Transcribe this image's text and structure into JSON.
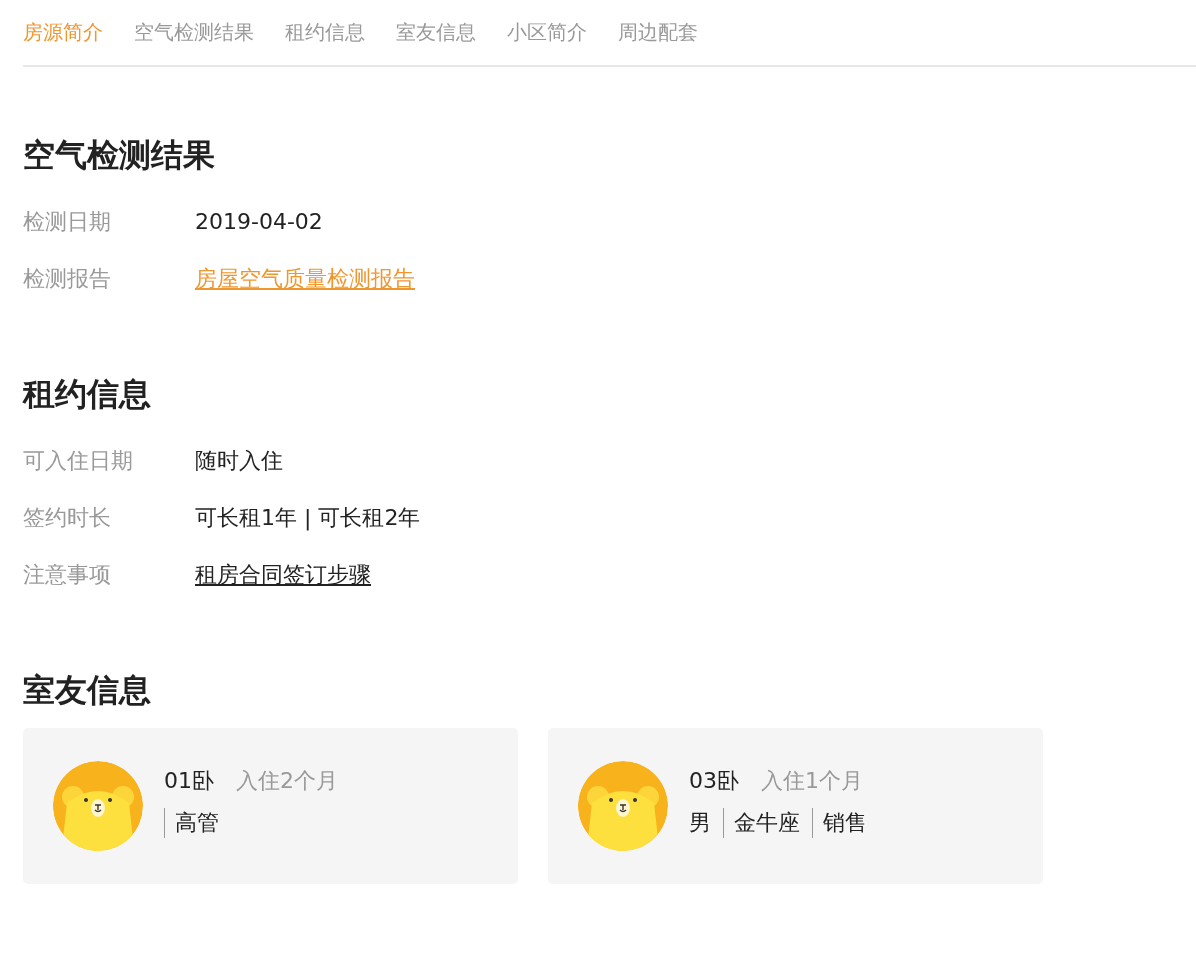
{
  "tabs": [
    {
      "label": "房源简介",
      "selected": true
    },
    {
      "label": "空气检测结果",
      "selected": false
    },
    {
      "label": "租约信息",
      "selected": false
    },
    {
      "label": "室友信息",
      "selected": false
    },
    {
      "label": "小区简介",
      "selected": false
    },
    {
      "label": "周边配套",
      "selected": false
    }
  ],
  "sections": [
    {
      "title": "空气检测结果",
      "rows": [
        {
          "label": "检测日期",
          "value": "2019-04-02",
          "kind": "text"
        },
        {
          "label": "检测报告",
          "value": "房屋空气质量检测报告",
          "kind": "accent-link"
        }
      ]
    },
    {
      "title": "租约信息",
      "rows": [
        {
          "label": "可入住日期",
          "value": "随时入住",
          "kind": "text"
        },
        {
          "label": "签约时长",
          "value": "可长租1年 | 可长租2年",
          "kind": "text"
        },
        {
          "label": "注意事项",
          "value": "租房合同签订步骤",
          "kind": "link"
        }
      ]
    },
    {
      "title": "室友信息",
      "roommates": [
        {
          "room": "01卧",
          "stay": "入住2个月",
          "tags": [
            {
              "text": "高管",
              "separated": true
            }
          ]
        },
        {
          "room": "03卧",
          "stay": "入住1个月",
          "tags": [
            {
              "text": "男",
              "separated": false
            },
            {
              "text": "金牛座",
              "separated": true
            },
            {
              "text": "销售",
              "separated": true
            }
          ]
        }
      ]
    }
  ]
}
